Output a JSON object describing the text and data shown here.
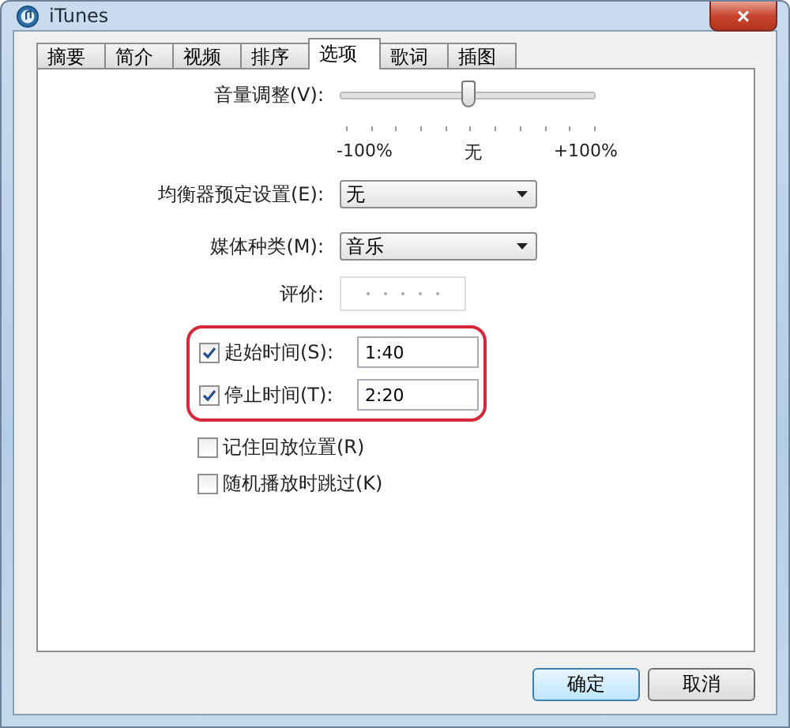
{
  "window": {
    "title": "iTunes",
    "close": "×"
  },
  "tabs": [
    {
      "label": "摘要",
      "selected": false
    },
    {
      "label": "简介",
      "selected": false
    },
    {
      "label": "视频",
      "selected": false
    },
    {
      "label": "排序",
      "selected": false
    },
    {
      "label": "选项",
      "selected": true
    },
    {
      "label": "歌词",
      "selected": false
    },
    {
      "label": "插图",
      "selected": false
    }
  ],
  "volume": {
    "label": "音量调整(V):",
    "level": 0.5,
    "min_label": "-100%",
    "mid_label": "无",
    "max_label": "+100%"
  },
  "equalizer": {
    "label": "均衡器预定设置(E):",
    "value": "无"
  },
  "media_kind": {
    "label": "媒体种类(M):",
    "value": "音乐"
  },
  "rating": {
    "label": "评价:",
    "stars": 0
  },
  "times": [
    {
      "label": "起始时间(S):",
      "checked": true,
      "value": "1:40"
    },
    {
      "label": "停止时间(T):",
      "checked": true,
      "value": "2:20"
    }
  ],
  "options": [
    {
      "label": "记住回放位置(R)",
      "checked": false
    },
    {
      "label": "随机播放时跳过(K)",
      "checked": false
    }
  ],
  "buttons": [
    {
      "label": "确定",
      "default": true
    },
    {
      "label": "取消",
      "default": false
    }
  ]
}
